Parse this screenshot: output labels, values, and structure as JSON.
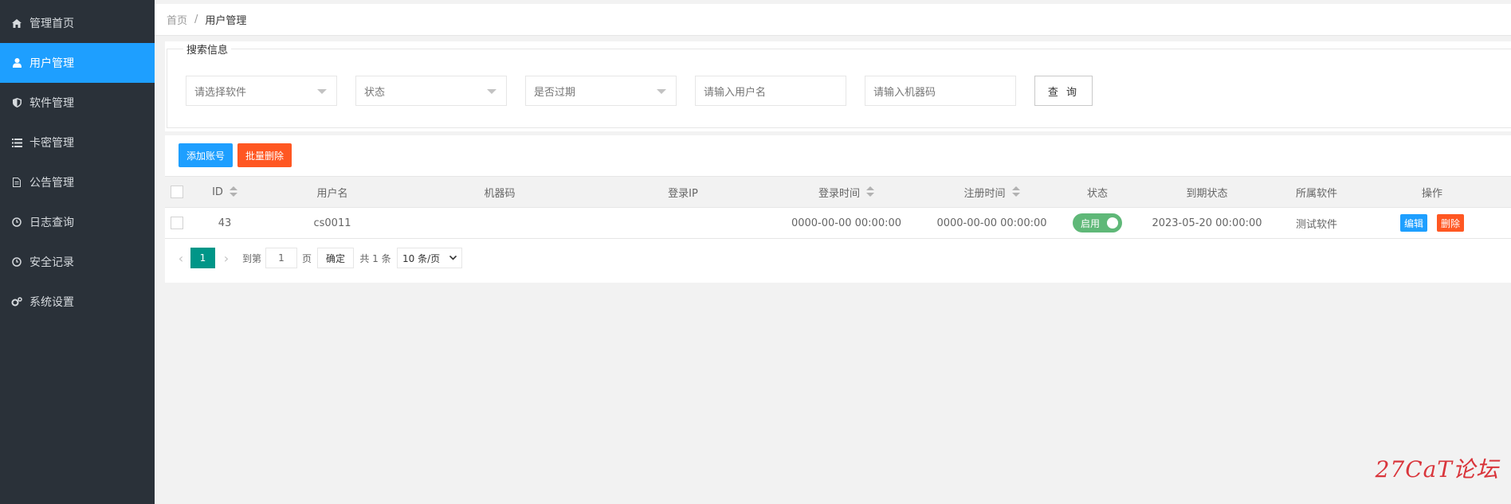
{
  "sidebar": {
    "items": [
      {
        "label": "管理首页",
        "icon": "home-icon"
      },
      {
        "label": "用户管理",
        "icon": "user-icon"
      },
      {
        "label": "软件管理",
        "icon": "shield-icon"
      },
      {
        "label": "卡密管理",
        "icon": "list-icon"
      },
      {
        "label": "公告管理",
        "icon": "file-icon"
      },
      {
        "label": "日志查询",
        "icon": "clock-icon"
      },
      {
        "label": "安全记录",
        "icon": "clock-icon"
      },
      {
        "label": "系统设置",
        "icon": "gears-icon"
      }
    ],
    "active_index": 1
  },
  "breadcrumb": {
    "home": "首页",
    "separator": "/",
    "current": "用户管理"
  },
  "search": {
    "legend": "搜索信息",
    "software_placeholder": "请选择软件",
    "status_placeholder": "状态",
    "expired_placeholder": "是否过期",
    "username_placeholder": "请输入用户名",
    "machine_placeholder": "请输入机器码",
    "query_label": "查 询"
  },
  "toolbar": {
    "add_label": "添加账号",
    "batch_delete_label": "批量删除"
  },
  "table": {
    "headers": {
      "id": "ID",
      "username": "用户名",
      "machine": "机器码",
      "login_ip": "登录IP",
      "login_time": "登录时间",
      "register_time": "注册时间",
      "status": "状态",
      "expire_status": "到期状态",
      "software": "所属软件",
      "actions": "操作"
    },
    "rows": [
      {
        "id": "43",
        "username": "cs0011",
        "machine": "",
        "login_ip": "",
        "login_time": "0000-00-00 00:00:00",
        "register_time": "0000-00-00 00:00:00",
        "status": "启用",
        "expire_status": "2023-05-20 00:00:00",
        "software": "测试软件",
        "edit_label": "编辑",
        "delete_label": "删除"
      }
    ]
  },
  "pagination": {
    "current_page": "1",
    "goto_label": "到第",
    "goto_value": "1",
    "page_unit": "页",
    "confirm_label": "确定",
    "total_text": "共 1 条",
    "page_size": "10 条/页"
  },
  "watermark": "27CaT论坛",
  "colors": {
    "sidebar_bg": "#2a3139",
    "accent": "#1e9fff",
    "danger": "#ff5722",
    "success": "#5fb878",
    "teal": "#009688"
  }
}
